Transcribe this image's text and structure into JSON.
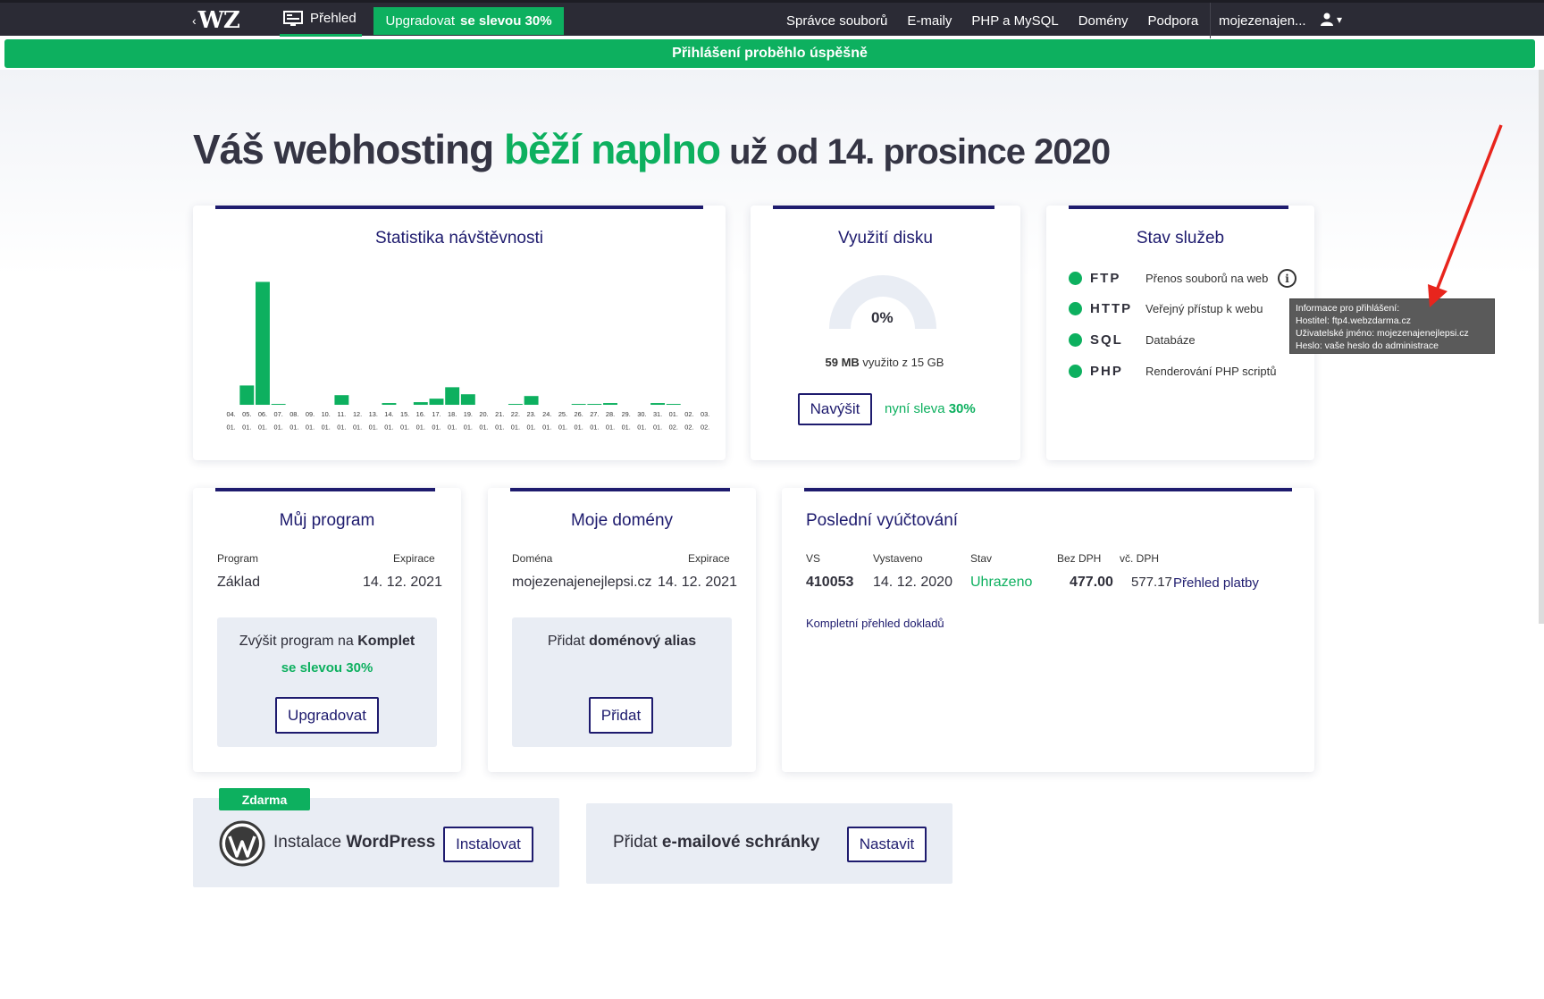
{
  "nav": {
    "logo_text": "WZ",
    "back_glyph": "‹",
    "overview_label": "Přehled",
    "upgrade_label": "Upgradovat",
    "upgrade_discount": "se slevou 30%",
    "links": [
      "Správce souborů",
      "E-maily",
      "PHP a MySQL",
      "Domény",
      "Podpora"
    ],
    "user": "mojezenajen...",
    "user_menu_glyph": "▾"
  },
  "flash_message": "Přihlášení proběhlo úspěšně",
  "headline": {
    "part1": "Váš webhosting ",
    "part2": "běží naplno",
    "part3": " už od 14. prosince 2020"
  },
  "stats": {
    "title": "Statistika návštěvnosti",
    "chart_data": {
      "type": "bar",
      "title": "Statistika návštěvnosti",
      "categories": [
        "04. 01.",
        "05. 01.",
        "06. 01.",
        "07. 01.",
        "08. 01.",
        "09. 01.",
        "10. 01.",
        "11. 01.",
        "12. 01.",
        "13. 01.",
        "14. 01.",
        "15. 01.",
        "16. 01.",
        "17. 01.",
        "18. 01.",
        "19. 01.",
        "20. 01.",
        "21. 01.",
        "22. 01.",
        "23. 01.",
        "24. 01.",
        "25. 01.",
        "26. 01.",
        "27. 01.",
        "28. 01.",
        "29. 01.",
        "30. 01.",
        "31. 01.",
        "01. 02.",
        "02. 02.",
        "03. 02."
      ],
      "values": [
        0,
        22,
        140,
        1,
        0,
        0,
        0,
        11,
        0,
        0,
        2,
        0,
        3,
        7,
        20,
        12,
        0,
        0,
        1,
        10,
        0,
        0,
        1,
        1,
        2,
        0,
        0,
        2,
        1,
        0,
        0
      ],
      "ylim": [
        0,
        145
      ],
      "color": "#0db05f"
    }
  },
  "disk": {
    "title": "Využití disku",
    "percent_label": "0%",
    "used_amount": "59 MB",
    "used_rest": " využito z 15 GB",
    "button": "Navýšit",
    "promo_prefix": "nyní sleva ",
    "promo_value": "30%"
  },
  "services": {
    "title": "Stav služeb",
    "items": [
      {
        "code": "FTP",
        "desc": "Přenos souborů na web"
      },
      {
        "code": "HTTP",
        "desc": "Veřejný přístup k webu"
      },
      {
        "code": "SQL",
        "desc": "Databáze"
      },
      {
        "code": "PHP",
        "desc": "Renderování PHP scriptů"
      }
    ],
    "status_color": "#0db05f",
    "info_glyph": "i",
    "tooltip": [
      "Informace pro přihlášení:",
      "Hostitel: ftp4.webzdarma.cz",
      "Uživatelské jméno: mojezenajenejlepsi.cz",
      "Heslo: vaše heslo do administrace"
    ]
  },
  "program": {
    "title": "Můj program",
    "label_program": "Program",
    "label_expiry": "Expirace",
    "program": "Základ",
    "expiry": "14. 12. 2021",
    "upgrade_text": "Zvýšit program na ",
    "upgrade_target": "Komplet",
    "upgrade_discount": "se slevou 30%",
    "button": "Upgradovat"
  },
  "domains": {
    "title": "Moje domény",
    "label_domain": "Doména",
    "label_expiry": "Expirace",
    "domain": "mojezenajenejlepsi.cz",
    "expiry": "14. 12. 2021",
    "alias_text": "Přidat ",
    "alias_bold": "doménový alias",
    "button": "Přidat"
  },
  "billing": {
    "title": "Poslední vyúčtování",
    "headers": [
      "VS",
      "Vystaveno",
      "Stav",
      "Bez DPH",
      "vč. DPH"
    ],
    "row": {
      "vs": "410053",
      "issued": "14. 12. 2020",
      "status": "Uhrazeno",
      "net": "477.00",
      "gross": "577.17",
      "link": "Přehled platby"
    },
    "docs_link": "Kompletní přehled dokladů"
  },
  "wordpress": {
    "badge": "Zdarma",
    "text": "Instalace ",
    "bold": "WordPress",
    "button": "Instalovat"
  },
  "email": {
    "text": "Přidat ",
    "bold": "e-mailové schránky",
    "button": "Nastavit"
  },
  "colors": {
    "accent": "#0db05f",
    "navy": "#1e1b6e",
    "topbar": "#2b2b35",
    "annotation_arrow": "#e8251d"
  }
}
